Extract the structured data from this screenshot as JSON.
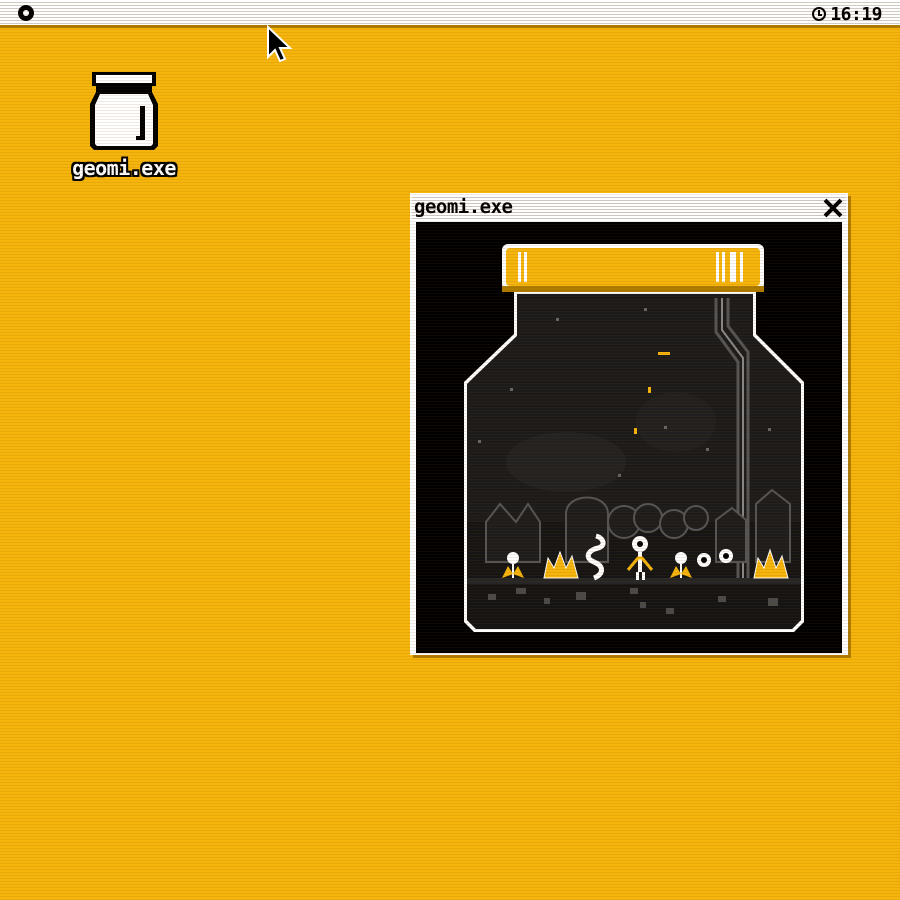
{
  "menubar": {
    "logo_icon": "circle-logo-icon",
    "clock_icon": "clock-icon",
    "time": "16:19"
  },
  "desktop": {
    "icons": [
      {
        "label": "geomi.exe",
        "icon": "jar-icon"
      }
    ]
  },
  "window": {
    "title": "geomi.exe",
    "close_icon": "close-x-icon",
    "content": "jar-terrarium-scene"
  },
  "colors": {
    "desktop": "#f5b50c",
    "accent": "#f5b50c",
    "window_bg": "#000000",
    "titlebar": "#ffffff"
  }
}
